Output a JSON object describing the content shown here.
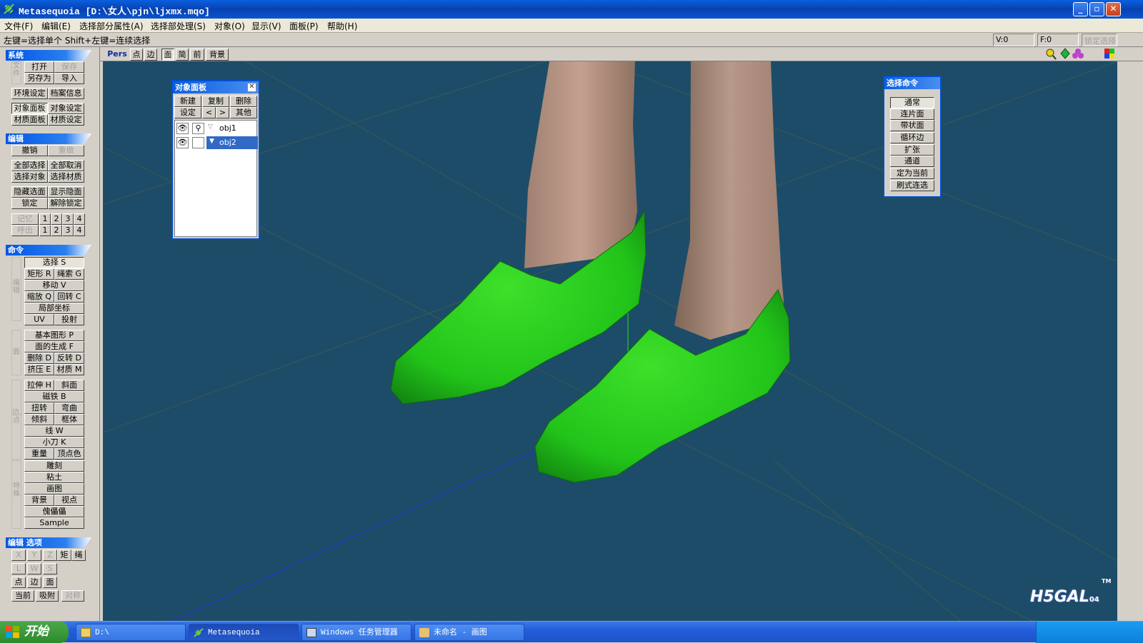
{
  "window": {
    "title": "Metasequoia [D:\\女人\\pjn\\ljxmx.mqo]",
    "colors": {
      "titlebar": "#0a55d0",
      "viewport_bg": "#1d4c68",
      "shoe": "#22cc1a"
    }
  },
  "menu": [
    "文件(F)",
    "编辑(E)",
    "选择部分属性(A)",
    "选择部处理(S)",
    "对象(O)",
    "显示(V)",
    "面板(P)",
    "帮助(H)"
  ],
  "status": {
    "hint": "左键=选择单个  Shift+左键=连续选择",
    "v": "V:0",
    "f": "F:0",
    "lock": "锁定选择"
  },
  "left": {
    "sections": {
      "system": "系统",
      "edit": "编辑",
      "command": "命令",
      "edit_options": "编辑 选项"
    },
    "system": {
      "side": "文件",
      "open": "打开",
      "save": "保存",
      "saveas": "另存为",
      "import": "导入",
      "env": "环境设定",
      "info": "档案信息",
      "objpanel": "对象面板",
      "objset": "对象设定",
      "matpanel": "材质面板",
      "matset": "材质设定"
    },
    "edit": {
      "undo": "撤销",
      "redo": "重做",
      "selall": "全部选择",
      "deselall": "全部取消",
      "selobj": "选择对象",
      "selmat": "选择材质",
      "hide": "隐藏选面",
      "show": "显示隐面",
      "lock": "锁定",
      "unlock": "解除锁定",
      "mem": "记忆",
      "recall": "呼出",
      "n1": "1",
      "n2": "2",
      "n3": "3",
      "n4": "4"
    },
    "cmd": {
      "grp1": "编辑",
      "select": "选择 S",
      "rect": "矩形 R",
      "rope": "绳索 G",
      "move": "移动 V",
      "scale": "缩放 Q",
      "rotate": "回转 C",
      "local": "局部坐标",
      "uv": "UV",
      "project": "投射",
      "grp2": "面",
      "basic": "基本图形 P",
      "facegen": "面的生成 F",
      "delete": "删除 D",
      "flip": "反转 D",
      "extrude": "挤压 E",
      "material": "材质 M",
      "grp3": "边,点",
      "stretch": "拉伸 H",
      "bevel": "斜面",
      "magnet": "磁铁 B",
      "twist": "扭转",
      "bend": "弯曲",
      "lean": "倾斜",
      "lattice": "框体",
      "line": "线 W",
      "knife": "小刀 K",
      "weight": "重量",
      "vcolor": "顶点色",
      "grp4": "特殊",
      "sculpt": "雕刻",
      "clay": "粘土",
      "paint": "画图",
      "bg": "背景",
      "view": "视点",
      "marionette": "傀儡儡",
      "sample": "Sample"
    },
    "opt": {
      "x": "X",
      "y": "Y",
      "z": "Z",
      "rect": "矩",
      "rope": "绳",
      "l": "L",
      "w": "W",
      "s": "S",
      "pt": "点",
      "edge": "边",
      "face": "面",
      "current": "当前",
      "snap": "吸附",
      "sym": "对称"
    }
  },
  "vtoolbar": {
    "pers": "Pers",
    "pt": "点",
    "edge": "边",
    "face": "面",
    "simple": "简",
    "front": "前",
    "bg": "背景"
  },
  "objpanel": {
    "title": "对象面板",
    "new": "新建",
    "copy": "复制",
    "delete": "删除",
    "setting": "设定",
    "prev": "<",
    "next": ">",
    "other": "其他",
    "objects": [
      "obj1",
      "obj2"
    ]
  },
  "selpanel": {
    "title": "选择命令",
    "items": [
      "通常",
      "连片面",
      "带状面",
      "循环边",
      "扩张",
      "通道",
      "定为当前",
      "刷式连选"
    ]
  },
  "taskbar": {
    "start": "开始",
    "tasks": [
      "D:\\",
      "Metasequoia",
      "Windows 任务管理器",
      "未命名 - 画图"
    ]
  },
  "watermark": {
    "text": "H5GAL",
    "suffix": "04",
    "tm": "TM"
  }
}
